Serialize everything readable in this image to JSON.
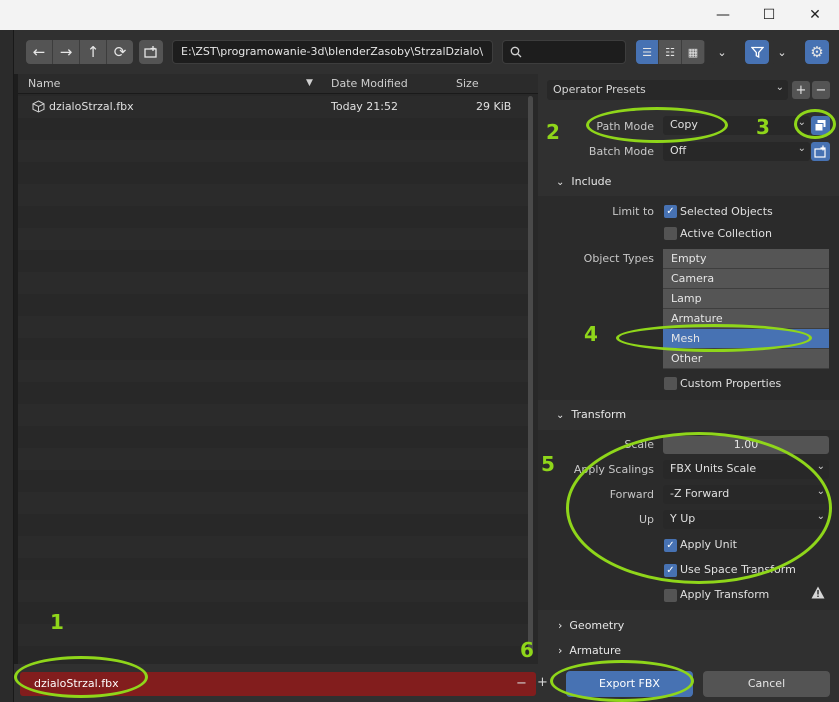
{
  "window": {
    "minimize": "—",
    "maximize": "☐",
    "close": "✕"
  },
  "toolbar": {
    "path": "E:\\ZST\\programowanie-3d\\blenderZasoby\\StrzalDzialo\\",
    "search_placeholder": ""
  },
  "columns": {
    "name": "Name",
    "date": "Date Modified",
    "size": "Size"
  },
  "files": [
    {
      "name": "dzialoStrzal.fbx",
      "date": "Today 21:52",
      "size": "29 KiB"
    }
  ],
  "panel": {
    "operator_presets": "Operator Presets",
    "path_mode_label": "Path Mode",
    "path_mode_value": "Copy",
    "batch_mode_label": "Batch Mode",
    "batch_mode_value": "Off",
    "include_title": "Include",
    "limit_to_label": "Limit to",
    "selected_objects": "Selected Objects",
    "active_collection": "Active Collection",
    "object_types_label": "Object Types",
    "object_types": [
      "Empty",
      "Camera",
      "Lamp",
      "Armature",
      "Mesh",
      "Other"
    ],
    "custom_properties": "Custom Properties",
    "transform_title": "Transform",
    "scale_label": "Scale",
    "scale_value": "1.00",
    "apply_scalings_label": "Apply Scalings",
    "apply_scalings_value": "FBX Units Scale",
    "forward_label": "Forward",
    "forward_value": "-Z Forward",
    "up_label": "Up",
    "up_value": "Y Up",
    "apply_unit": "Apply Unit",
    "use_space_transform": "Use Space Transform",
    "apply_transform": "Apply Transform",
    "geometry_title": "Geometry",
    "armature_title": "Armature"
  },
  "bottom": {
    "filename": "dzialoStrzal.fbx",
    "export_label": "Export FBX",
    "cancel_label": "Cancel",
    "minus": "−",
    "plus": "+"
  },
  "annotations": {
    "n1": "1",
    "n2": "2",
    "n3": "3",
    "n4": "4",
    "n5": "5",
    "n6": "6"
  },
  "colors": {
    "accent": "#4772b3",
    "annotation": "#8fd61a",
    "filename_bg": "#821d1d"
  }
}
